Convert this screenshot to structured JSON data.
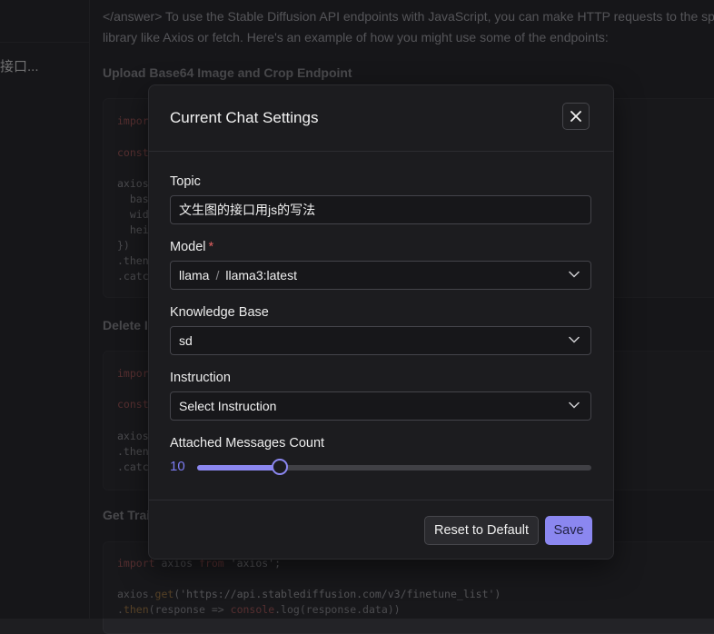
{
  "sidebar": {
    "chat_item": "接口..."
  },
  "article": {
    "para_line1": "</answer> To use the Stable Diffusion API endpoints with JavaScript, you can make HTTP requests to the spec",
    "para_line2": "library like Axios or fetch. Here's an example of how you might use some of the endpoints:",
    "heading1": "Upload Base64 Image and Crop Endpoint",
    "heading2": "Delete I",
    "heading3": "Get Trai",
    "code1": [
      "impor",
      "",
      "const",
      "",
      "axios",
      "  bas",
      "  wid",
      "  hei",
      "})",
      ".then",
      ".catc"
    ],
    "code2": [
      "impor",
      "",
      "const",
      "",
      "axios",
      ".then",
      ".catc"
    ],
    "code3": {
      "l1_kw": "import",
      "l1_mid": " axios ",
      "l1_kw2": "from",
      "l1_str": " 'axios';",
      "l2_a": "axios.",
      "l2_fn": "get",
      "l2_b": "('https://api.stablediffusion.com/v3/finetune_list')",
      "l3_a": ".",
      "l3_fn": "then",
      "l3_b": "(response => ",
      "l3_fn2": "console",
      "l3_c": ".log(response.data))"
    }
  },
  "modal": {
    "title": "Current Chat Settings",
    "topic": {
      "label": "Topic",
      "value": "文生图的接口用js的写法"
    },
    "model": {
      "label": "Model",
      "required": "*",
      "provider": "llama",
      "separator": "/",
      "name": "llama3:latest"
    },
    "knowledge_base": {
      "label": "Knowledge Base",
      "value": "sd"
    },
    "instruction": {
      "label": "Instruction",
      "value": "Select Instruction"
    },
    "messages_count": {
      "label": "Attached Messages Count",
      "value": "10",
      "fraction": 0.21
    },
    "reset_label": "Reset to Default",
    "save_label": "Save"
  },
  "colors": {
    "accent": "#8b87f0",
    "required": "#e0605f",
    "background": "#1c1c1f"
  },
  "icons": {
    "close": "close-icon",
    "chevron": "chevron-down-icon"
  }
}
